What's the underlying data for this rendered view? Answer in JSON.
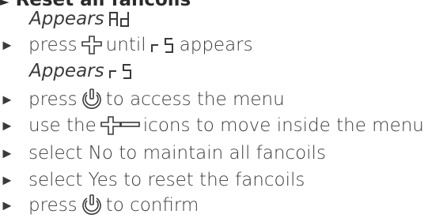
{
  "heading": "Reset all fancoils",
  "appears_label": "Appears",
  "arrow_glyph": "►",
  "lines": {
    "l2_press": "press",
    "l2_until": "until",
    "l2_appears": "appears",
    "l4_press": "press",
    "l4_rest": "to access the menu",
    "l5_use": "use the",
    "l5_rest": "icons to move inside the menu",
    "l6": "select No to maintain all fancoils",
    "l7": "select Yes to reset the fancoils",
    "l8_press": "press",
    "l8_rest": "to confirm"
  },
  "icons": [
    "plus-icon",
    "minus-icon",
    "power-icon",
    "segment-display-ad-icon",
    "segment-display-rs-icon"
  ],
  "colors": {
    "text": "#3a3a3a",
    "heading": "#2b2b2b"
  }
}
